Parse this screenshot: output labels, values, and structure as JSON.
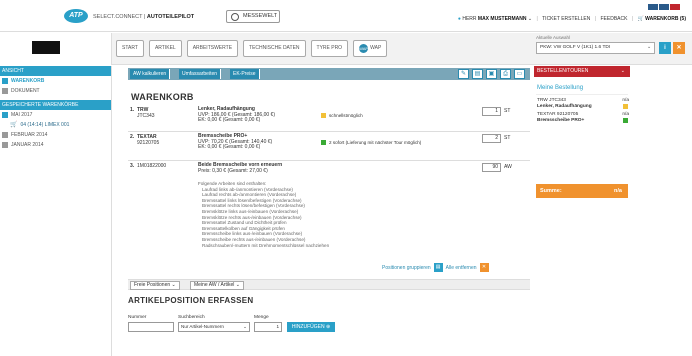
{
  "header": {
    "logo_text": "ATP",
    "connect_prefix": "SELECT.CONNECT |",
    "connect_app": "AUTOTEILEPILOT",
    "messewelt_label": "MESSEWELT",
    "user_prefix": "HERR",
    "user_name": "MAX MUSTERMANN",
    "ticket_link": "TICKET ERSTELLEN",
    "feedback_link": "FEEDBACK",
    "cart_link": "WARENKORB (5)"
  },
  "nav": {
    "tabs": [
      "START",
      "ARTIKEL",
      "ARBEITSWERTE",
      "TECHNISCHE DATEN",
      "TYRE PRO"
    ],
    "wap_label": "WAP",
    "wap_icon_text": "wap",
    "vehicle_label": "Aktuelle Auswahl",
    "vehicle_value": "PKW: VW GOLF V (1K1) 1.6 TDI"
  },
  "sidebar": {
    "view_head": "ANSICHT",
    "view_items": [
      "WARENKORB",
      "DOKUMENT"
    ],
    "saved_head": "GESPEICHERTE WARENKÖRBE",
    "saved_items": [
      "MAI 2017",
      "04 (14:14) LIMEX 001",
      "FEBRUAR 2014",
      "JANUAR 2014"
    ]
  },
  "toolbar": {
    "btn1": "AW kalkulieren",
    "btn2": "Umfassarbeiten",
    "btn3": "EK-Preise"
  },
  "cart": {
    "title": "WARENKORB",
    "rows": [
      {
        "num": "1.",
        "brand": "TRW",
        "code": "JTC343",
        "name": "Lenker, Radaufhängung",
        "uvp": "UVP: 186,00 € (Gesamt: 186,00 €)",
        "ek": "EK: 0,00 € (Gesamt: 0,00 €)",
        "stock": "schnellstmöglich",
        "stock_color": "#f2c037",
        "qty": "1",
        "unit": "ST"
      },
      {
        "num": "2.",
        "brand": "TEXTAR",
        "code": "92120705",
        "name": "Bremsscheibe PRO+",
        "uvp": "UVP: 70,20 € (Gesamt: 140,40 €)",
        "ek": "EK: 0,00 € (Gesamt: 0,00 €)",
        "stock": "2 sofort (Lieferung mit nächster Tour möglich)",
        "stock_color": "#3aaa35",
        "qty": "2",
        "unit": "ST"
      },
      {
        "num": "3.",
        "code": "1M01822000",
        "name": "Beide Bremsscheibe vorn erneuern",
        "price": "Preis: 0,30 € (Gesamt: 27,00 €)",
        "work_intro": "Folgende Arbeiten sind enthalten:",
        "work": [
          "Laufrad links ab-/anmontieren (Vorderachse)",
          "Laufrad rechts ab-/anmontieren (Vorderachse)",
          "Bremssattel links lösen/befestigen (Vorderachse)",
          "Bremssattel rechts lösen/befestigen (Vorderachse)",
          "Bremsklötze links aus-/einbauen (Vorderachse)",
          "Bremsklötze rechts aus-/einbauen (Vorderachse)",
          "Bremssattel Zustand und Dichtheit prüfen",
          "Bremssattelkolben auf Gängigkeit prüfen",
          "Bremsscheibe links aus-/einbauen (Vorderachse)",
          "Bremsscheibe rechts aus-/einbauen (Vorderachse)",
          "Radschrauben/-muttern mit Drehmomentschlüssel nachziehen"
        ],
        "qty": "90",
        "unit": "AW"
      }
    ],
    "group_label": "Positionen gruppieren",
    "remove_label": "Alle entfernen"
  },
  "freepos": {
    "tab1": "Freie Positionen",
    "tab2": "Meine AW / Artikel"
  },
  "article": {
    "title": "ARTIKELPOSITION ERFASSEN",
    "nummer_label": "Nummer",
    "suchbereich_label": "Suchbereich",
    "suchbereich_value": "Nur Artikel-Nummern",
    "menge_label": "Menge",
    "menge_value": "1",
    "add_label": "HINZUFÜGEN"
  },
  "order": {
    "head": "BESTELLEN/TOUREN",
    "title": "Meine Bestellung",
    "items": [
      {
        "code": "TRW JTC343",
        "name": "Lenker, Radaufhängung",
        "value": "n/a",
        "color": "#f2c037"
      },
      {
        "code": "TEXTAR 92120705",
        "name": "Bremsscheibe PRO+",
        "value": "n/a",
        "color": "#3aaa35"
      }
    ],
    "sum_label": "Summe:",
    "sum_value": "n/a"
  },
  "colors": {
    "accent": "#2aa0c8",
    "order_red": "#c0262e",
    "orange": "#f0922e"
  }
}
